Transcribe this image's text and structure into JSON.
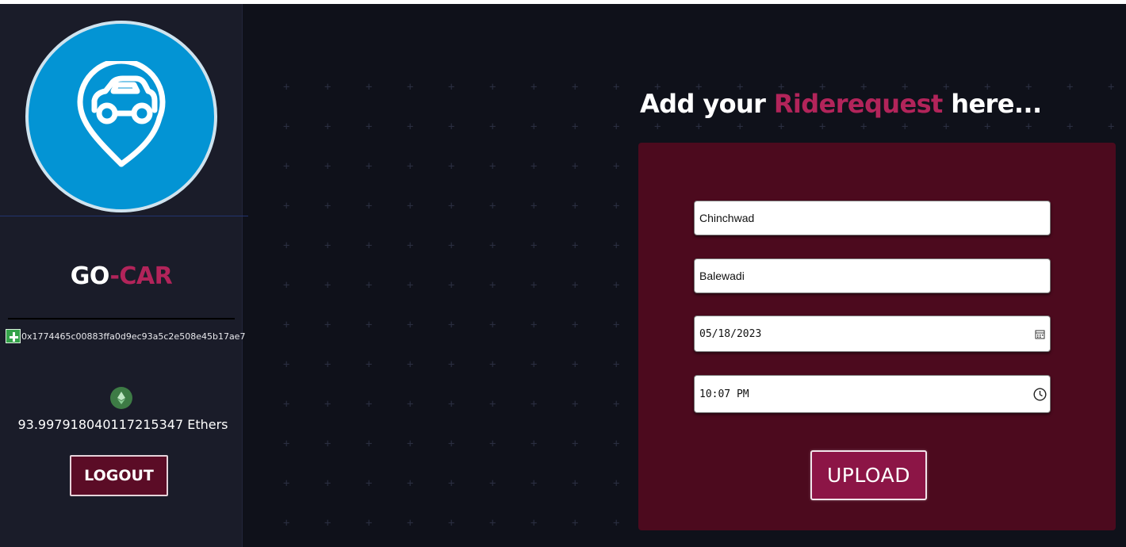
{
  "brand": {
    "part1": "GO",
    "part2": "-CAR"
  },
  "account": {
    "address": "0x1774465c00883ffa0d9ec93a5c2e508e45b17ae7",
    "balance": "93.997918040117215347 Ethers"
  },
  "sidebar": {
    "logout_label": "LOGOUT"
  },
  "heading": {
    "prefix": "Add your ",
    "accent": "Riderequest",
    "suffix": " here..."
  },
  "form": {
    "pickup_value": "Chinchwad",
    "drop_value": "Balewadi",
    "date_value": "05/18/2023",
    "time_value": "10:07 PM",
    "upload_label": "UPLOAD"
  },
  "icons": {
    "logo": "car-location-pin-icon",
    "address": "add-icon",
    "eth": "ethereum-icon",
    "calendar": "calendar-icon",
    "clock": "clock-icon"
  },
  "colors": {
    "accent": "#b2245a",
    "panel": "#4c0a1e",
    "logo_bg": "#0394d4",
    "button": "#8c1546"
  }
}
